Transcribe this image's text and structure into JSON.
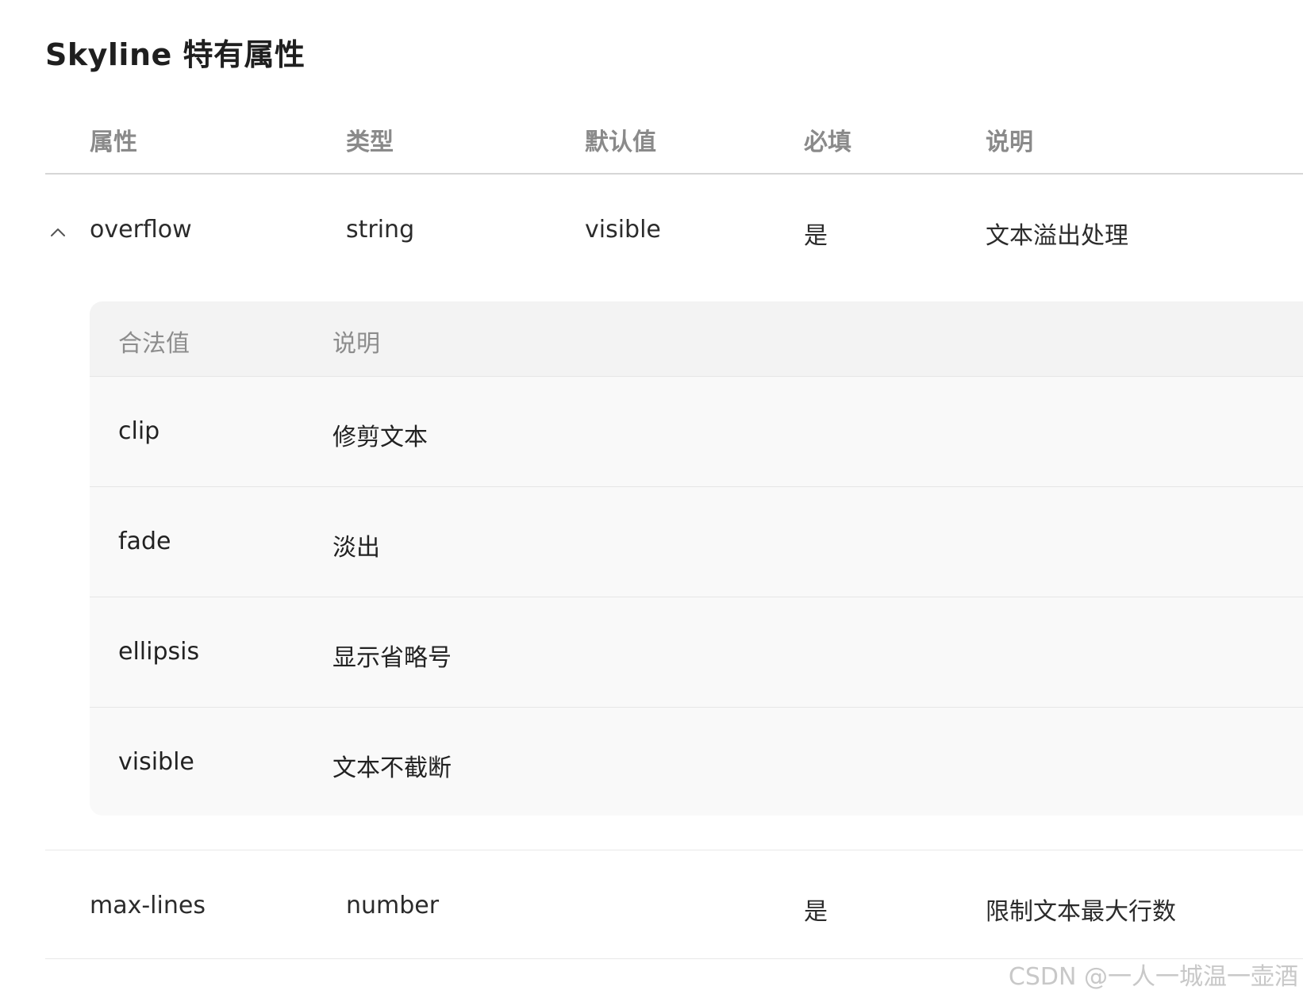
{
  "section": {
    "title": "Skyline 特有属性"
  },
  "table": {
    "headers": [
      "属性",
      "类型",
      "默认值",
      "必填",
      "说明"
    ],
    "rows": [
      {
        "name": "overflow",
        "type": "string",
        "default": "visible",
        "required": "是",
        "description": "文本溢出处理",
        "expanded": true,
        "toggle_icon": "chevron-up-icon",
        "sub_table": {
          "headers": [
            "合法值",
            "说明"
          ],
          "rows": [
            {
              "value": "clip",
              "description": "修剪文本"
            },
            {
              "value": "fade",
              "description": "淡出"
            },
            {
              "value": "ellipsis",
              "description": "显示省略号"
            },
            {
              "value": "visible",
              "description": "文本不截断"
            }
          ]
        }
      },
      {
        "name": "max-lines",
        "type": "number",
        "default": "",
        "required": "是",
        "description": "限制文本最大行数"
      }
    ]
  },
  "watermark": {
    "text": "CSDN @一人一城温一壶酒"
  },
  "colors": {
    "header_text": "#8a8a8a",
    "body_text": "#2b2b2b",
    "panel_bg": "#f9f9f9",
    "divider": "#d6d6d6"
  }
}
